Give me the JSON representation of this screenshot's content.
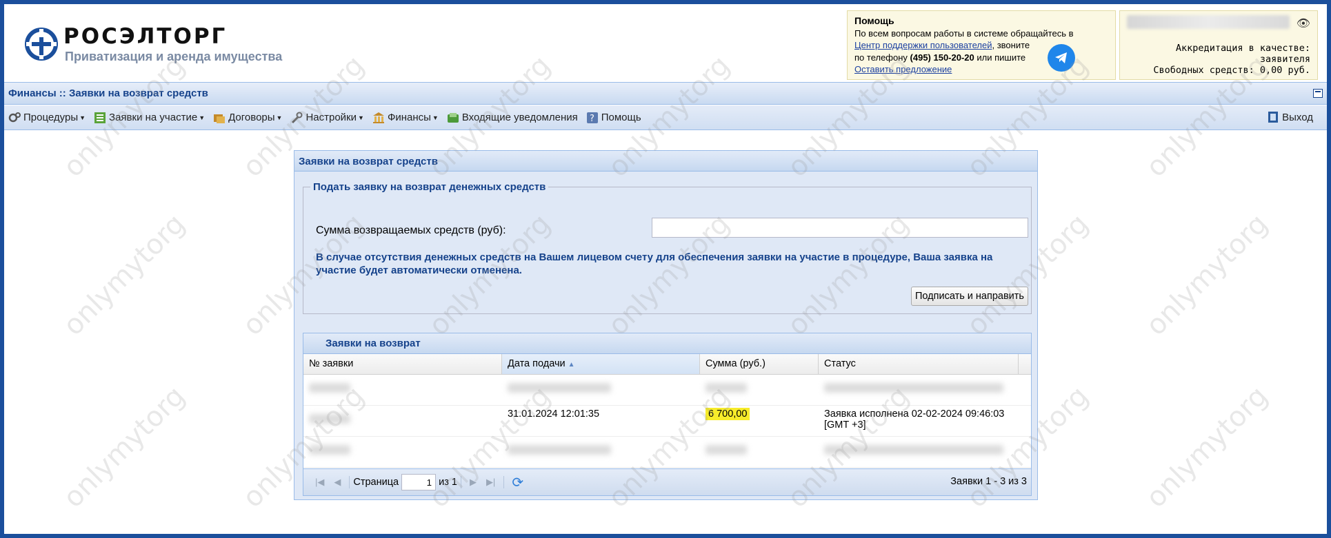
{
  "header": {
    "logo_title": "РОСЭЛТОРГ",
    "logo_subtitle": "Приватизация и аренда имущества",
    "help": {
      "title": "Помощь",
      "line1": "По всем вопросам работы в системе обращайтесь в",
      "support_link": "Центр поддержки пользователей",
      "line2_tail": ", звоните",
      "line3_pre": "по телефону ",
      "phone": "(495) 150-20-20",
      "line3_post": " или пишите",
      "suggest_link": "Оставить предложение"
    },
    "account": {
      "accreditation": "Аккредитация в качестве: заявителя",
      "funds": "Свободных средств: 0,00 руб."
    }
  },
  "title_bar": "Финансы :: Заявки на возврат средств",
  "toolbar": {
    "items": [
      {
        "label": "Процедуры",
        "icon": "gears-icon"
      },
      {
        "label": "Заявки на участие",
        "icon": "spreadsheet-icon"
      },
      {
        "label": "Договоры",
        "icon": "folders-icon"
      },
      {
        "label": "Настройки",
        "icon": "wrench-icon"
      },
      {
        "label": "Финансы",
        "icon": "bank-icon"
      },
      {
        "label": "Входящие уведомления",
        "icon": "inbox-icon"
      },
      {
        "label": "Помощь",
        "icon": "help-icon"
      }
    ],
    "exit_label": "Выход"
  },
  "panel": {
    "title": "Заявки на возврат средств",
    "form": {
      "legend": "Подать заявку на возврат денежных средств",
      "amount_label": "Сумма возвращаемых средств (руб):",
      "amount_value": "",
      "note": "В случае отсутствия денежных средств на Вашем лицевом счету для обеспечения заявки на участие в процедуре, Ваша заявка на участие будет автоматически отменена.",
      "submit_label": "Подписать и направить"
    },
    "grid": {
      "title": "Заявки на возврат",
      "columns": [
        "№ заявки",
        "Дата подачи",
        "Сумма (руб.)",
        "Статус"
      ],
      "rows": [
        {
          "number": "",
          "date": "",
          "amount": "",
          "status": ""
        },
        {
          "number": "",
          "date": "31.01.2024 12:01:35",
          "amount": "6 700,00",
          "status": "Заявка исполнена 02-02-2024 09:46:03 [GMT +3]"
        },
        {
          "number": "",
          "date": "",
          "amount": "",
          "status": ""
        }
      ],
      "pager": {
        "page_label": "Страница",
        "page_value": "1",
        "of_label": "из 1",
        "info": "Заявки 1 - 3 из 3"
      }
    }
  },
  "watermark": "onlymytorg"
}
